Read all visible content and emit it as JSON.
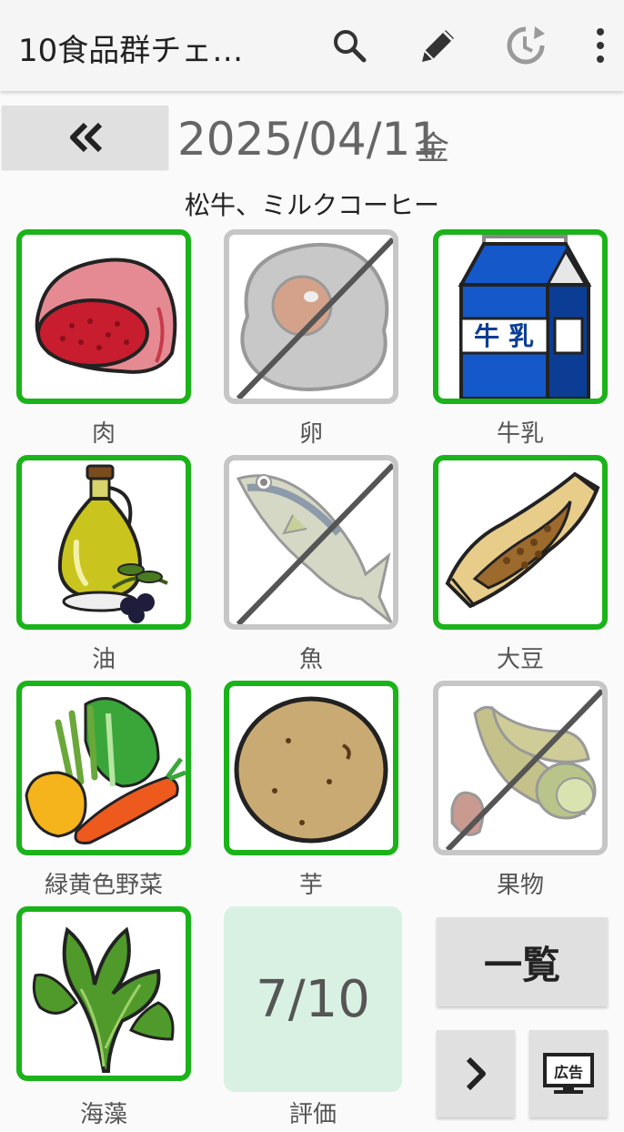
{
  "app": {
    "title": "10食品群チェ…"
  },
  "toolbar": {
    "search_icon": "search-icon",
    "edit_icon": "pencil-icon",
    "history_icon": "history-icon",
    "menu_icon": "more-vert-icon"
  },
  "nav": {
    "prev_icon": "double-chevron-left-icon",
    "date": "2025/04/11",
    "weekday": "金"
  },
  "memo": "松牛、ミルクコーヒー",
  "foods": [
    {
      "label": "肉",
      "checked": true
    },
    {
      "label": "卵",
      "checked": false
    },
    {
      "label": "牛乳",
      "checked": true
    },
    {
      "label": "油",
      "checked": true
    },
    {
      "label": "魚",
      "checked": false
    },
    {
      "label": "大豆",
      "checked": true
    },
    {
      "label": "緑黄色野菜",
      "checked": true
    },
    {
      "label": "芋",
      "checked": true
    },
    {
      "label": "果物",
      "checked": false
    },
    {
      "label": "海藻",
      "checked": true
    }
  ],
  "milk_carton_text": "牛 乳",
  "score": {
    "value": "7/10",
    "label": "評価"
  },
  "buttons": {
    "list": "一覧",
    "next_icon": "chevron-right-icon",
    "ad_text": "広告"
  },
  "colors": {
    "checked_border": "#1ab31a",
    "unchecked_border": "#c6c6c6",
    "score_bg": "#d8f1e3"
  }
}
